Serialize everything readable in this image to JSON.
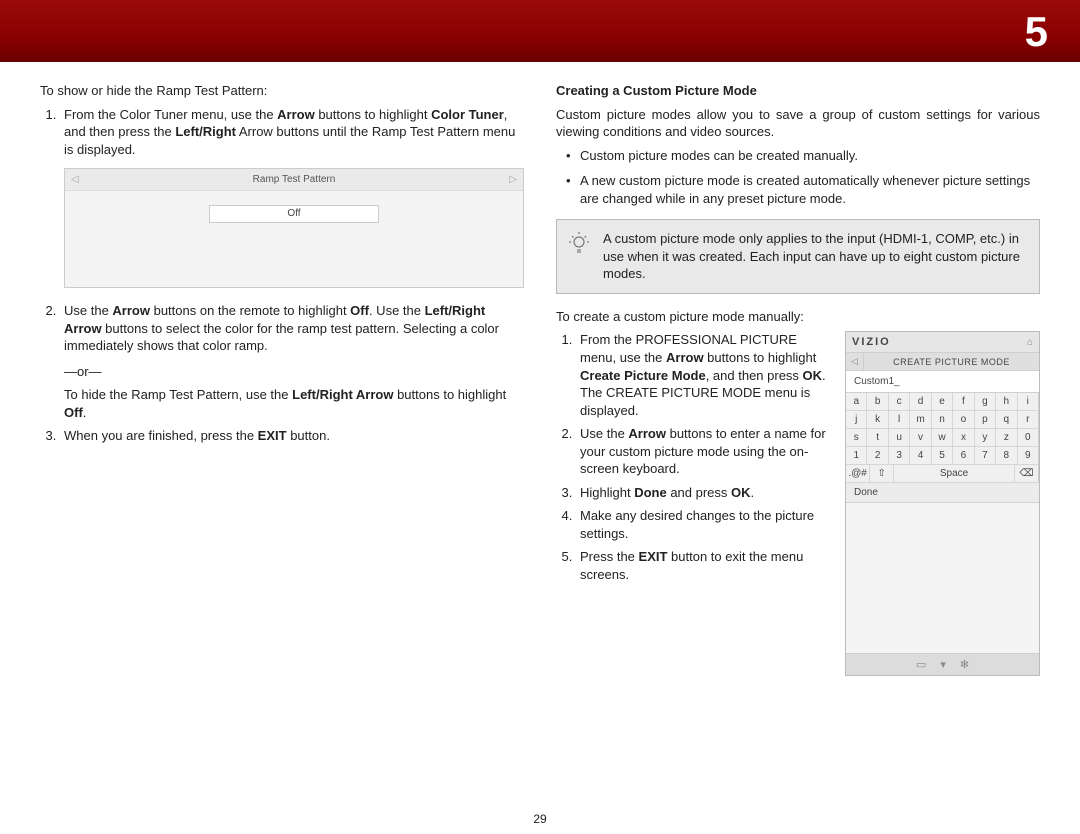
{
  "chapter": "5",
  "page_number": "29",
  "left": {
    "intro": "To show or hide the Ramp Test Pattern:",
    "step1_a": "From the Color Tuner menu, use the ",
    "step1_b": " buttons to highlight ",
    "step1_c": ", and then press the ",
    "step1_d": " Arrow buttons until the Ramp Test Pattern menu is displayed.",
    "bold_arrow": "Arrow",
    "bold_colortuner": "Color Tuner",
    "bold_lr": "Left/Right",
    "panel": {
      "title": "Ramp Test Pattern",
      "value": "Off"
    },
    "step2_a": "Use the ",
    "step2_b": " buttons on the remote to highlight ",
    "step2_c": ". Use the ",
    "step2_d": " buttons to select the color for the ramp test pattern. Selecting a color immediately shows that color ramp.",
    "bold_off": "Off",
    "bold_lrarrow": "Left/Right Arrow",
    "or": "—or—",
    "step2_e": "To hide the Ramp Test Pattern, use the ",
    "step2_f": " buttons to highlight ",
    "step2_g": ".",
    "step3_a": "When you are finished, press the ",
    "step3_b": " button.",
    "bold_exit": "EXIT"
  },
  "right": {
    "heading": "Creating a Custom Picture Mode",
    "intro": "Custom picture modes allow you to save a group of custom settings for various viewing conditions and video sources.",
    "bullets": [
      "Custom picture modes can be created manually.",
      "A new custom picture mode is created automatically whenever picture settings are changed while in any preset picture mode."
    ],
    "tip": "A custom picture mode only applies to the input (HDMI-1, COMP, etc.) in use when it was created. Each input can have up to eight custom picture modes.",
    "intro2": "To create a custom picture mode manually:",
    "step1_a": "From the PROFESSIONAL PICTURE menu, use the ",
    "step1_b": " buttons to highlight ",
    "step1_c": ", and then press ",
    "step1_d": ". The CREATE PICTURE MODE menu is displayed.",
    "bold_arrow": "Arrow",
    "bold_cpm": "Create Picture Mode",
    "bold_ok": "OK",
    "step2_a": "Use the ",
    "step2_b": " buttons to enter a name for your custom picture mode using the on-screen keyboard.",
    "step3_a": "Highlight ",
    "step3_b": " and press ",
    "step3_c": ".",
    "bold_done": "Done",
    "step4": "Make any desired changes to the picture settings.",
    "step5_a": "Press the ",
    "step5_b": " button to exit the menu screens.",
    "bold_exit": "EXIT"
  },
  "osd": {
    "brand": "VIZIO",
    "menu_title": "CREATE PICTURE MODE",
    "input_value": "Custom1_",
    "keys": [
      "a",
      "b",
      "c",
      "d",
      "e",
      "f",
      "g",
      "h",
      "i",
      "j",
      "k",
      "l",
      "m",
      "n",
      "o",
      "p",
      "q",
      "r",
      "s",
      "t",
      "u",
      "v",
      "w",
      "x",
      "y",
      "z",
      "0",
      "1",
      "2",
      "3",
      "4",
      "5",
      "6",
      "7",
      "8",
      "9"
    ],
    "sym": ".@#",
    "shift": "⇧",
    "space": "Space",
    "back": "⌫",
    "done": "Done",
    "footer": [
      "▭",
      "▾",
      "✻"
    ]
  }
}
